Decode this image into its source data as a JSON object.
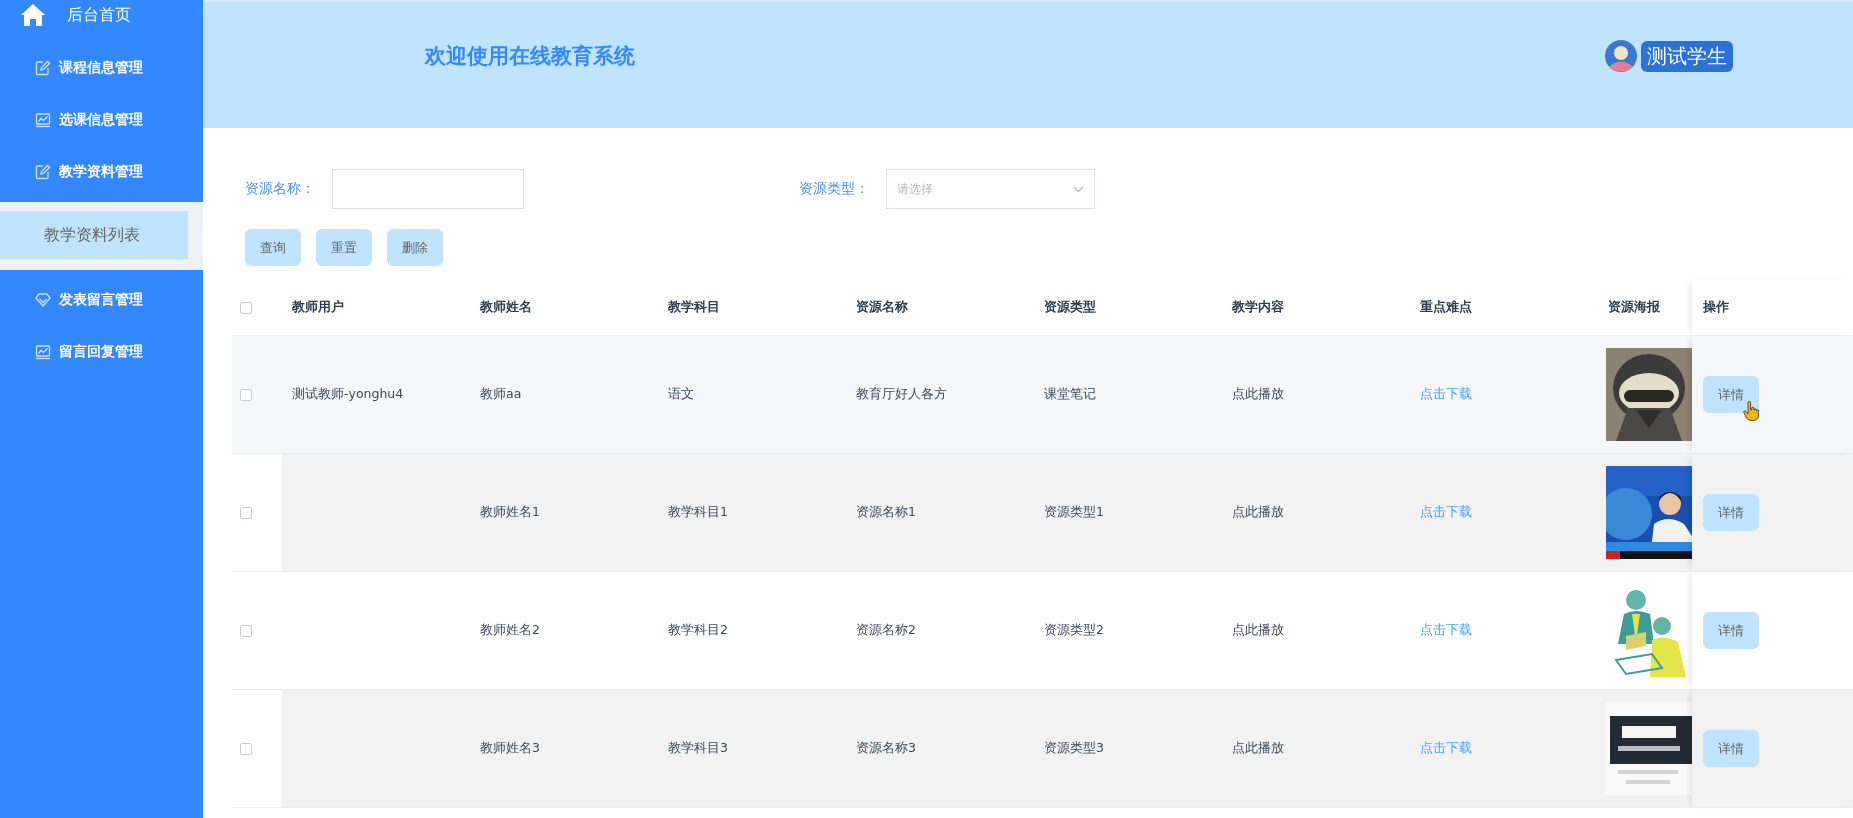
{
  "sidebar": {
    "home": "后台首页",
    "items": [
      {
        "label": "课程信息管理",
        "kind": "menu",
        "selected": false
      },
      {
        "label": "选课信息管理",
        "kind": "menu",
        "selected": false
      },
      {
        "label": "教学资料管理",
        "kind": "menu",
        "selected": false
      },
      {
        "label": "教学资料列表",
        "kind": "submenu",
        "selected": true
      },
      {
        "label": "发表留言管理",
        "kind": "menu",
        "selected": false
      },
      {
        "label": "留言回复管理",
        "kind": "menu",
        "selected": false
      }
    ]
  },
  "header": {
    "title": "欢迎使用在线教育系统",
    "user": "测试学生"
  },
  "filters": [
    {
      "label": "资源名称：",
      "kind": "input"
    },
    {
      "label": "资源类型：",
      "kind": "select",
      "placeholder": "请选择"
    }
  ],
  "buttons": [
    "查询",
    "重置",
    "删除"
  ],
  "table": {
    "header_checked": false,
    "columns": [
      "教师用户",
      "教师姓名",
      "教学科目",
      "资源名称",
      "资源类型",
      "教学内容",
      "重点难点",
      "资源海报",
      "操作"
    ],
    "rows": [
      {
        "checked": false,
        "hovered": true,
        "striped": false,
        "teacher_user": "测试教师-yonghu4",
        "teacher_name": "教师aa",
        "subject": "语文",
        "resource_name": "教育厅好人各方",
        "resource_type": "课堂笔记",
        "content": "点此播放",
        "key_points": "点击下载",
        "action": "详情"
      },
      {
        "checked": false,
        "hovered": false,
        "striped": true,
        "teacher_name": "教师姓名1",
        "subject": "教学科目1",
        "resource_name": "资源名称1",
        "resource_type": "资源类型1",
        "content": "点此播放",
        "key_points": "点击下载",
        "action": "详情"
      },
      {
        "checked": false,
        "hovered": false,
        "striped": false,
        "teacher_name": "教师姓名2",
        "subject": "教学科目2",
        "resource_name": "资源名称2",
        "resource_type": "资源类型2",
        "content": "点此播放",
        "key_points": "点击下载",
        "action": "详情"
      },
      {
        "checked": false,
        "hovered": false,
        "striped": true,
        "teacher_name": "教师姓名3",
        "subject": "教学科目3",
        "resource_name": "资源名称3",
        "resource_type": "资源类型3",
        "content": "点此播放",
        "key_points": "点击下载",
        "action": "详情"
      }
    ]
  }
}
